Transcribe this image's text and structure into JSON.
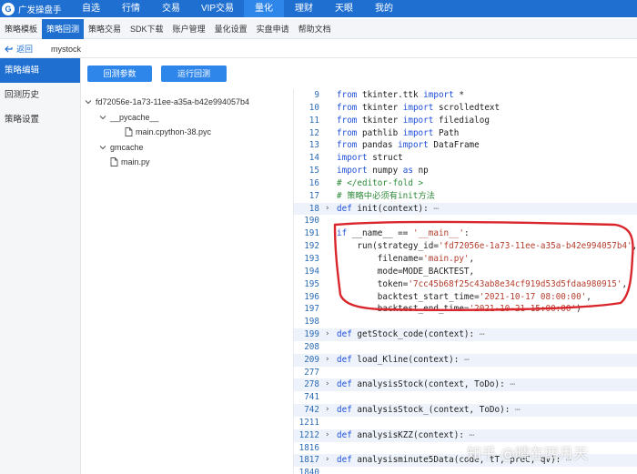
{
  "app": {
    "brand": "广发操盘手",
    "top_nav": [
      {
        "label": "自选"
      },
      {
        "label": "行情"
      },
      {
        "label": "交易"
      },
      {
        "label": "VIP交易"
      },
      {
        "label": "量化",
        "active": true
      },
      {
        "label": "理财"
      },
      {
        "label": "天眼"
      },
      {
        "label": "我的"
      }
    ]
  },
  "subtabs": [
    {
      "label": "策略模板"
    },
    {
      "label": "策略回测",
      "active": true
    },
    {
      "label": "策略交易"
    },
    {
      "label": "SDK下载"
    },
    {
      "label": "账户管理"
    },
    {
      "label": "量化设置"
    },
    {
      "label": "实盘申请"
    },
    {
      "label": "帮助文档"
    }
  ],
  "breadcrumb": {
    "back_label": "返回",
    "strategy_name": "mystock"
  },
  "sidebar": {
    "items": [
      {
        "label": "策略编辑",
        "active": true
      },
      {
        "label": "回测历史"
      },
      {
        "label": "策略设置"
      }
    ]
  },
  "buttons": {
    "params": "回测参数",
    "run": "运行回测"
  },
  "file_tree": [
    {
      "label": "fd72056e-1a73-11ee-a35a-b42e994057b4",
      "type": "folder",
      "depth": 0
    },
    {
      "label": "__pycache__",
      "type": "folder",
      "depth": 1
    },
    {
      "label": "main.cpython-38.pyc",
      "type": "file",
      "depth": 2
    },
    {
      "label": "gmcache",
      "type": "folder",
      "depth": 1
    },
    {
      "label": "main.py",
      "type": "file",
      "depth": 1
    }
  ],
  "code_lines": [
    {
      "n": "9",
      "text": "from tkinter.ttk import *"
    },
    {
      "n": "10",
      "text": "from tkinter import scrolledtext"
    },
    {
      "n": "11",
      "text": "from tkinter import filedialog"
    },
    {
      "n": "12",
      "text": "from pathlib import Path"
    },
    {
      "n": "13",
      "text": "from pandas import DataFrame"
    },
    {
      "n": "14",
      "text": "import struct"
    },
    {
      "n": "15",
      "text": "import numpy as np"
    },
    {
      "n": "16",
      "text": "# </editor-fold >"
    },
    {
      "n": "17",
      "text": "# 策略中必须有init方法"
    },
    {
      "n": "18",
      "text": "def init(context):",
      "folded": true
    },
    {
      "n": "190",
      "text": ""
    },
    {
      "n": "191",
      "text": "if __name__ == '__main__':"
    },
    {
      "n": "192",
      "text": "    run(strategy_id='fd72056e-1a73-11ee-a35a-b42e994057b4',"
    },
    {
      "n": "193",
      "text": "        filename='main.py',"
    },
    {
      "n": "194",
      "text": "        mode=MODE_BACKTEST,"
    },
    {
      "n": "195",
      "text": "        token='7cc45b68f25c43ab8e34cf919d53d5fdaa980915',"
    },
    {
      "n": "196",
      "text": "        backtest_start_time='2021-10-17 08:00:00',"
    },
    {
      "n": "197",
      "text": "        backtest_end_time='2021-10-21 15:00:00')"
    },
    {
      "n": "198",
      "text": ""
    },
    {
      "n": "199",
      "text": "def getStock_code(context):",
      "folded": true
    },
    {
      "n": "208",
      "text": ""
    },
    {
      "n": "209",
      "text": "def load_Kline(context):",
      "folded": true
    },
    {
      "n": "277",
      "text": ""
    },
    {
      "n": "278",
      "text": "def analysisStock(context, ToDo):",
      "folded": true
    },
    {
      "n": "741",
      "text": ""
    },
    {
      "n": "742",
      "text": "def analysisStock_(context, ToDo):",
      "folded": true
    },
    {
      "n": "1211",
      "text": ""
    },
    {
      "n": "1212",
      "text": "def analysisKZZ(context):",
      "folded": true
    },
    {
      "n": "1816",
      "text": ""
    },
    {
      "n": "1817",
      "text": "def analysisminute5Data(code, tT, preC, qv):",
      "folded": true
    },
    {
      "n": "1840",
      "text": ""
    }
  ],
  "watermark": "知乎 @晴在四月天",
  "colors": {
    "brand_blue": "#1f6fd1",
    "accent_blue": "#2f86ea",
    "annotation_red": "#d9262c"
  }
}
